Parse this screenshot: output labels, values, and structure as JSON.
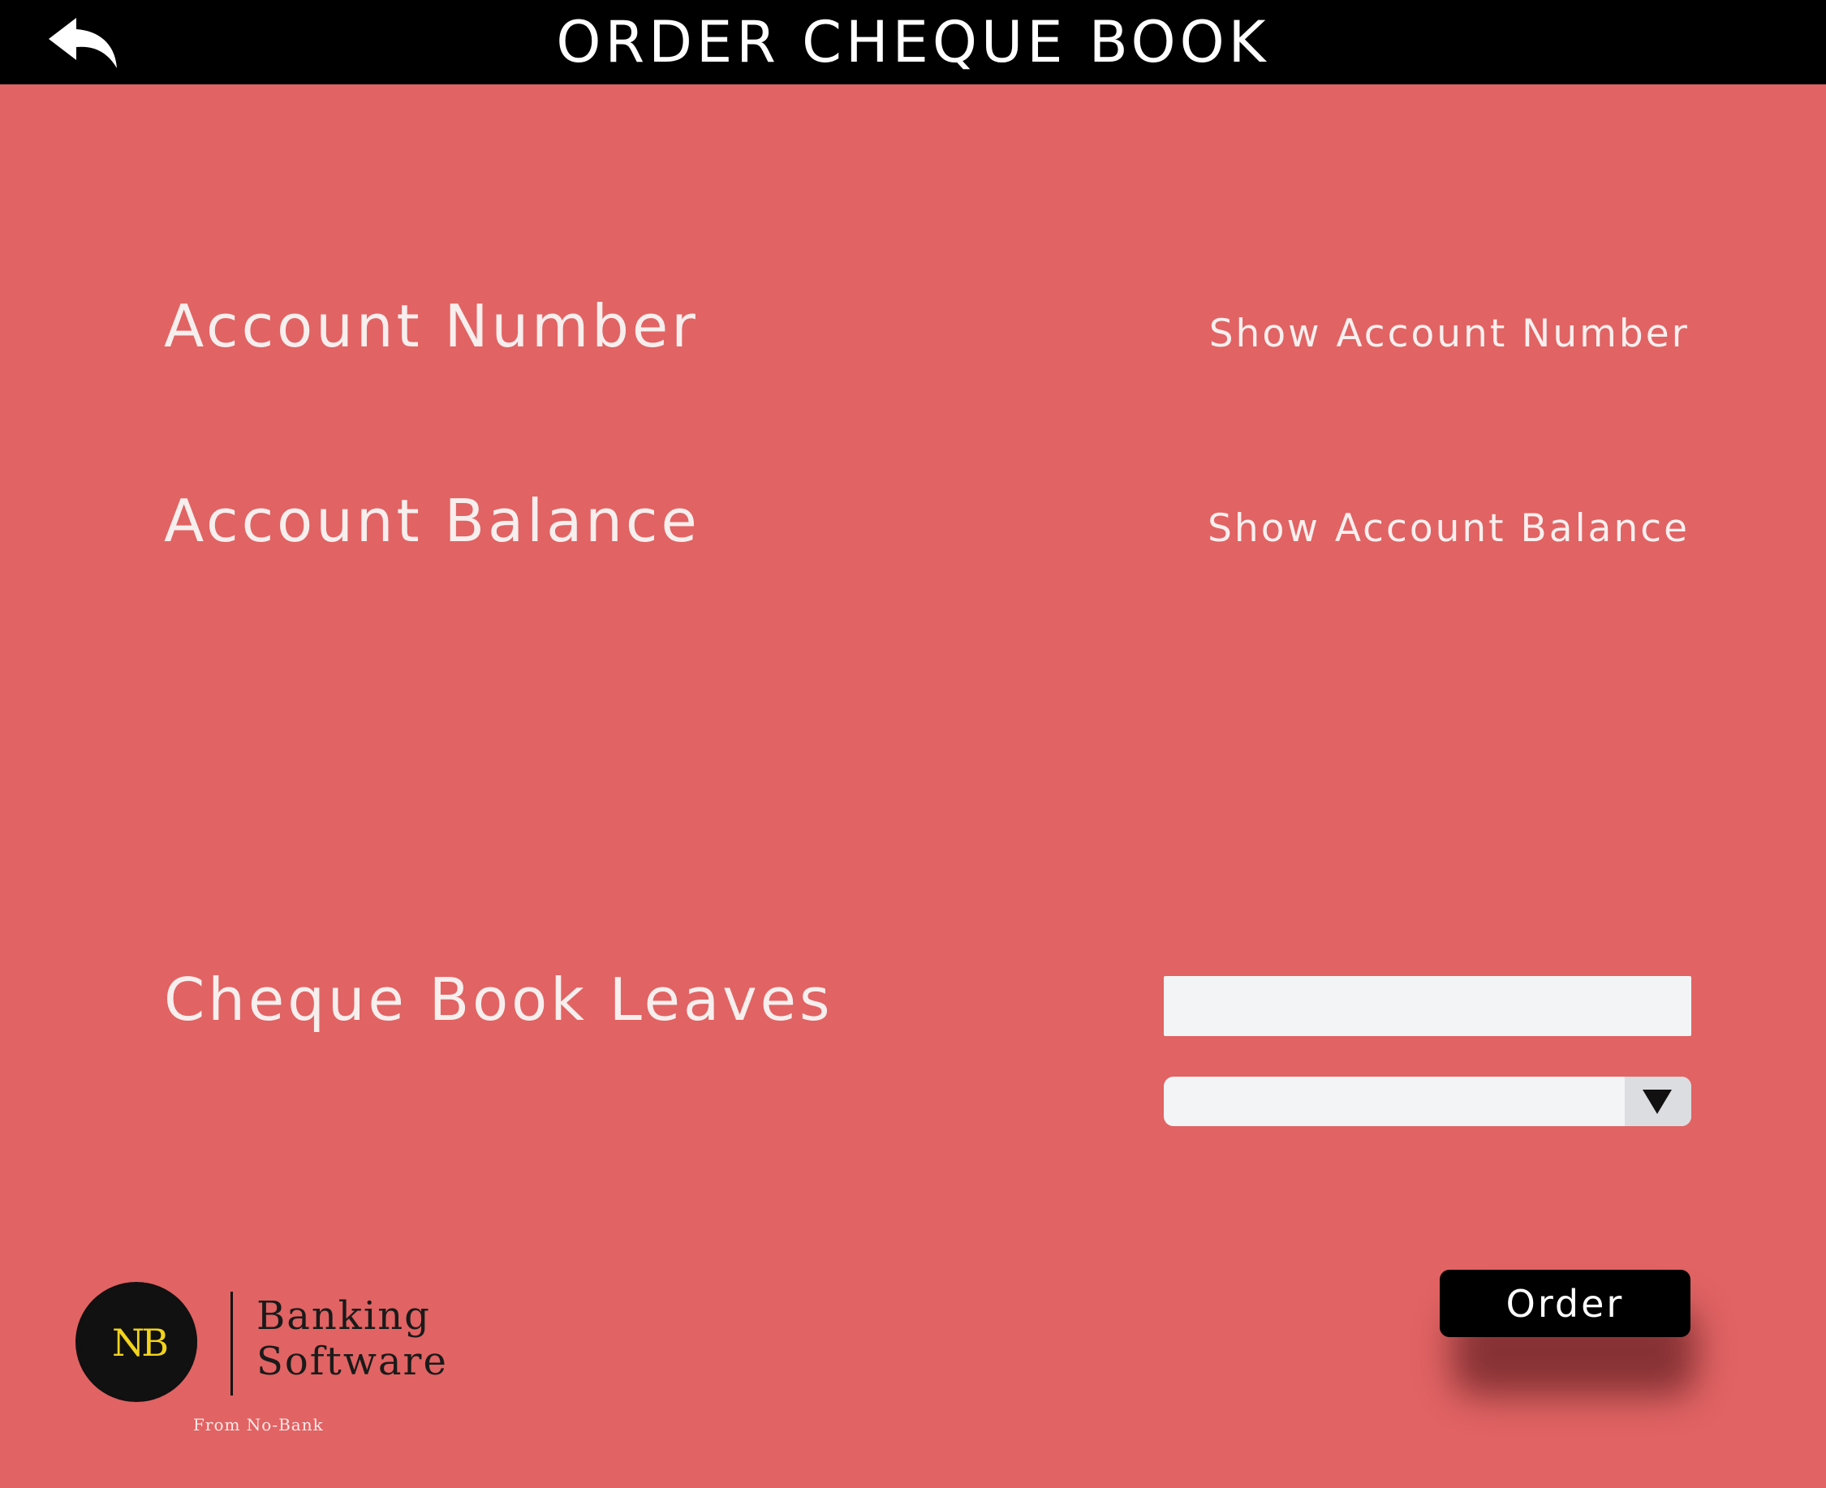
{
  "header": {
    "title": "ORDER CHEQUE BOOK",
    "back_icon": "back-arrow-icon"
  },
  "account": {
    "number_label": "Account Number",
    "number_link": "Show Account Number",
    "balance_label": "Account Balance",
    "balance_link": "Show Account Balance"
  },
  "cheque": {
    "leaves_label": "Cheque Book Leaves",
    "leaves_input_value": "",
    "leaves_input_placeholder": "",
    "select_value": ""
  },
  "actions": {
    "order_label": "Order"
  },
  "branding": {
    "logo_letters": "NB",
    "line1": "Banking",
    "line2": "Software",
    "tagline": "From No-Bank"
  },
  "colors": {
    "background": "#e16363",
    "header_bg": "#000000",
    "logo_accent": "#f2d31b"
  }
}
